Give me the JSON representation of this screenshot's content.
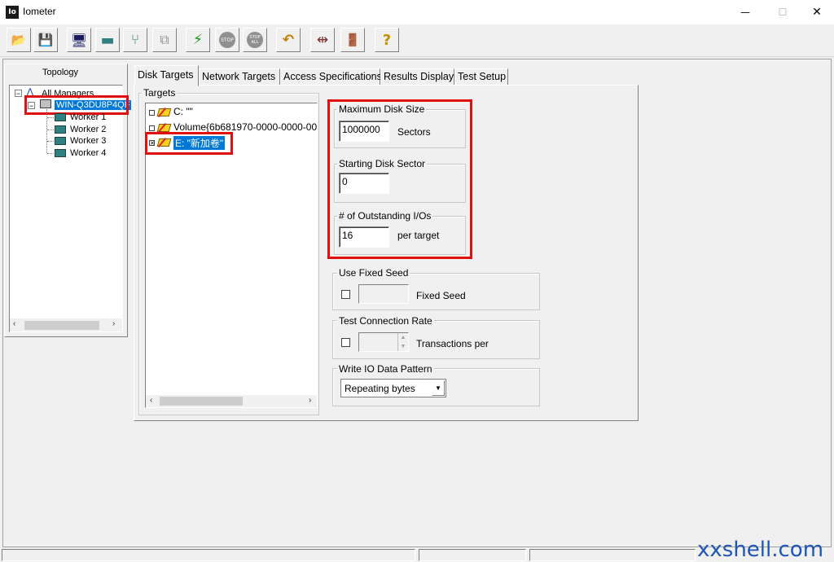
{
  "window": {
    "title": "Iometer",
    "icon_text": "Io",
    "minimize": "—",
    "maximize": "☐",
    "close": "✕"
  },
  "toolbar": {
    "items": [
      {
        "name": "open-config-button",
        "glyph": "📂"
      },
      {
        "name": "save-config-button",
        "glyph": "💾"
      },
      {
        "name": "start-manager-button",
        "glyph": "🖥"
      },
      {
        "name": "start-disk-worker-button",
        "glyph": "▬"
      },
      {
        "name": "start-network-worker-button",
        "glyph": "⑂"
      },
      {
        "name": "duplicate-worker-button",
        "glyph": "⧉"
      },
      {
        "name": "start-tests-button",
        "glyph": "⚡"
      },
      {
        "name": "stop-button",
        "glyph": "STOP"
      },
      {
        "name": "stop-all-button",
        "glyph": "STOP ALL"
      },
      {
        "name": "reset-workers-button",
        "glyph": "↶"
      },
      {
        "name": "disconnect-button",
        "glyph": "⇹"
      },
      {
        "name": "exit-button",
        "glyph": "🚪"
      },
      {
        "name": "about-button",
        "glyph": "?"
      }
    ]
  },
  "topology": {
    "label": "Topology",
    "root": "All Managers",
    "manager": "WIN-Q3DU8P4QF",
    "workers": [
      "Worker 1",
      "Worker 2",
      "Worker 3",
      "Worker 4"
    ]
  },
  "tabs": [
    "Disk Targets",
    "Network Targets",
    "Access Specifications",
    "Results Display",
    "Test Setup"
  ],
  "targets": {
    "label": "Targets",
    "items": [
      "C: \"\"",
      "Volume{6b681970-0000-0000-00(",
      "E: \"新加卷\""
    ]
  },
  "max_disk_size": {
    "label": "Maximum Disk Size",
    "value": "1000000",
    "unit": "Sectors"
  },
  "starting_sector": {
    "label": "Starting Disk Sector",
    "value": "0"
  },
  "outstanding": {
    "label": "# of Outstanding I/Os",
    "value": "16",
    "unit": "per target"
  },
  "fixed_seed": {
    "label": "Use Fixed Seed",
    "checkbox_label": "Fixed Seed"
  },
  "conn_rate": {
    "label": "Test Connection Rate",
    "checkbox_label": "Transactions per"
  },
  "write_io": {
    "label": "Write IO Data Pattern",
    "selected": "Repeating bytes"
  },
  "watermark": "xxshell.com",
  "colors": {
    "highlight_box": "#e01010",
    "selection": "#0078d7"
  }
}
